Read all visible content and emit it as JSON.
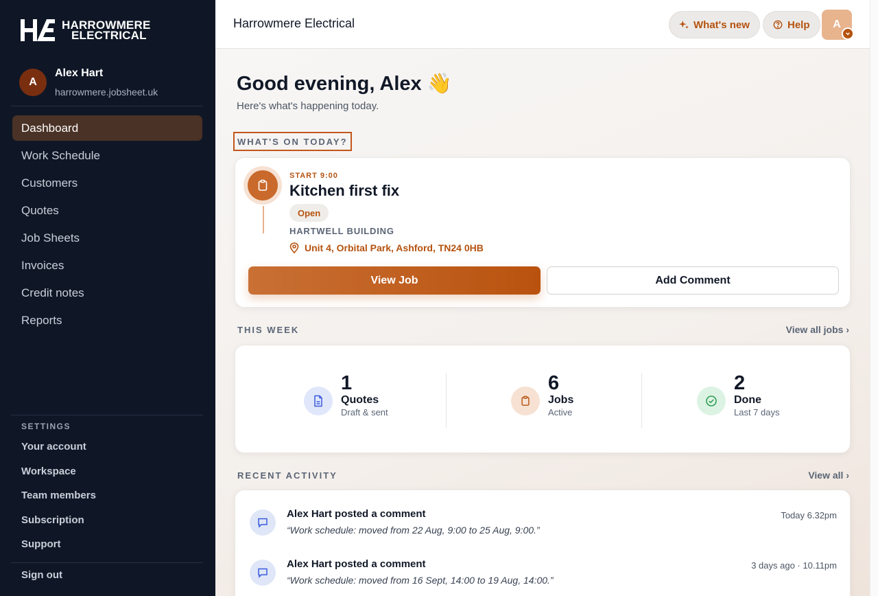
{
  "brand": {
    "logo_line1": "HARROWMERE",
    "logo_line2": "ELECTRICAL",
    "monogram": "HE"
  },
  "user": {
    "initial": "A",
    "name": "Alex Hart",
    "domain": "harrowmere.jobsheet.uk"
  },
  "nav": {
    "items": [
      {
        "label": "Dashboard",
        "active": true
      },
      {
        "label": "Work Schedule"
      },
      {
        "label": "Customers"
      },
      {
        "label": "Quotes"
      },
      {
        "label": "Job Sheets"
      },
      {
        "label": "Invoices"
      },
      {
        "label": "Credit notes"
      },
      {
        "label": "Reports"
      }
    ]
  },
  "settings": {
    "title": "SETTINGS",
    "items": [
      "Your account",
      "Workspace",
      "Team members",
      "Subscription",
      "Support"
    ],
    "sign_out": "Sign out"
  },
  "topbar": {
    "title": "Harrowmere Electrical",
    "whats_new": "What's new",
    "help": "Help",
    "avatar_initial": "A"
  },
  "main": {
    "greeting": "Good evening, Alex 👋",
    "subgreeting": "Here's what's happening today.",
    "today_label": "WHAT'S ON TODAY?",
    "job": {
      "start": "START 9:00",
      "title": "Kitchen first fix",
      "status": "Open",
      "client": "HARTWELL BUILDING",
      "address": "Unit 4, Orbital Park, Ashford, TN24 0HB",
      "view_button": "View Job",
      "comment_button": "Add Comment"
    },
    "week": {
      "label": "THIS WEEK",
      "view_all": "View all jobs ›",
      "stats": [
        {
          "value": "1",
          "name": "Quotes",
          "sub": "Draft & sent",
          "icon": "document-icon",
          "color": "#e0e7fb"
        },
        {
          "value": "6",
          "name": "Jobs",
          "sub": "Active",
          "icon": "clipboard-icon",
          "color": "#f6e1d2"
        },
        {
          "value": "2",
          "name": "Done",
          "sub": "Last 7 days",
          "icon": "check-circle-icon",
          "color": "#dcf3e3"
        }
      ]
    },
    "activity": {
      "label": "RECENT ACTIVITY",
      "view_all": "View all ›",
      "items": [
        {
          "title": "Alex Hart posted a comment",
          "text": "“Work schedule: moved from 22 Aug, 9:00 to 25 Aug, 9:00.”",
          "time": "Today 6.32pm"
        },
        {
          "title": "Alex Hart posted a comment",
          "text": "“Work schedule: moved from 16 Sept, 14:00 to 19 Aug, 14:00.”",
          "time": "3 days ago · 10.11pm"
        }
      ]
    }
  },
  "colors": {
    "accent": "#b5520f",
    "sidebar_bg": "#0f1726",
    "active_nav": "#4a3226"
  }
}
